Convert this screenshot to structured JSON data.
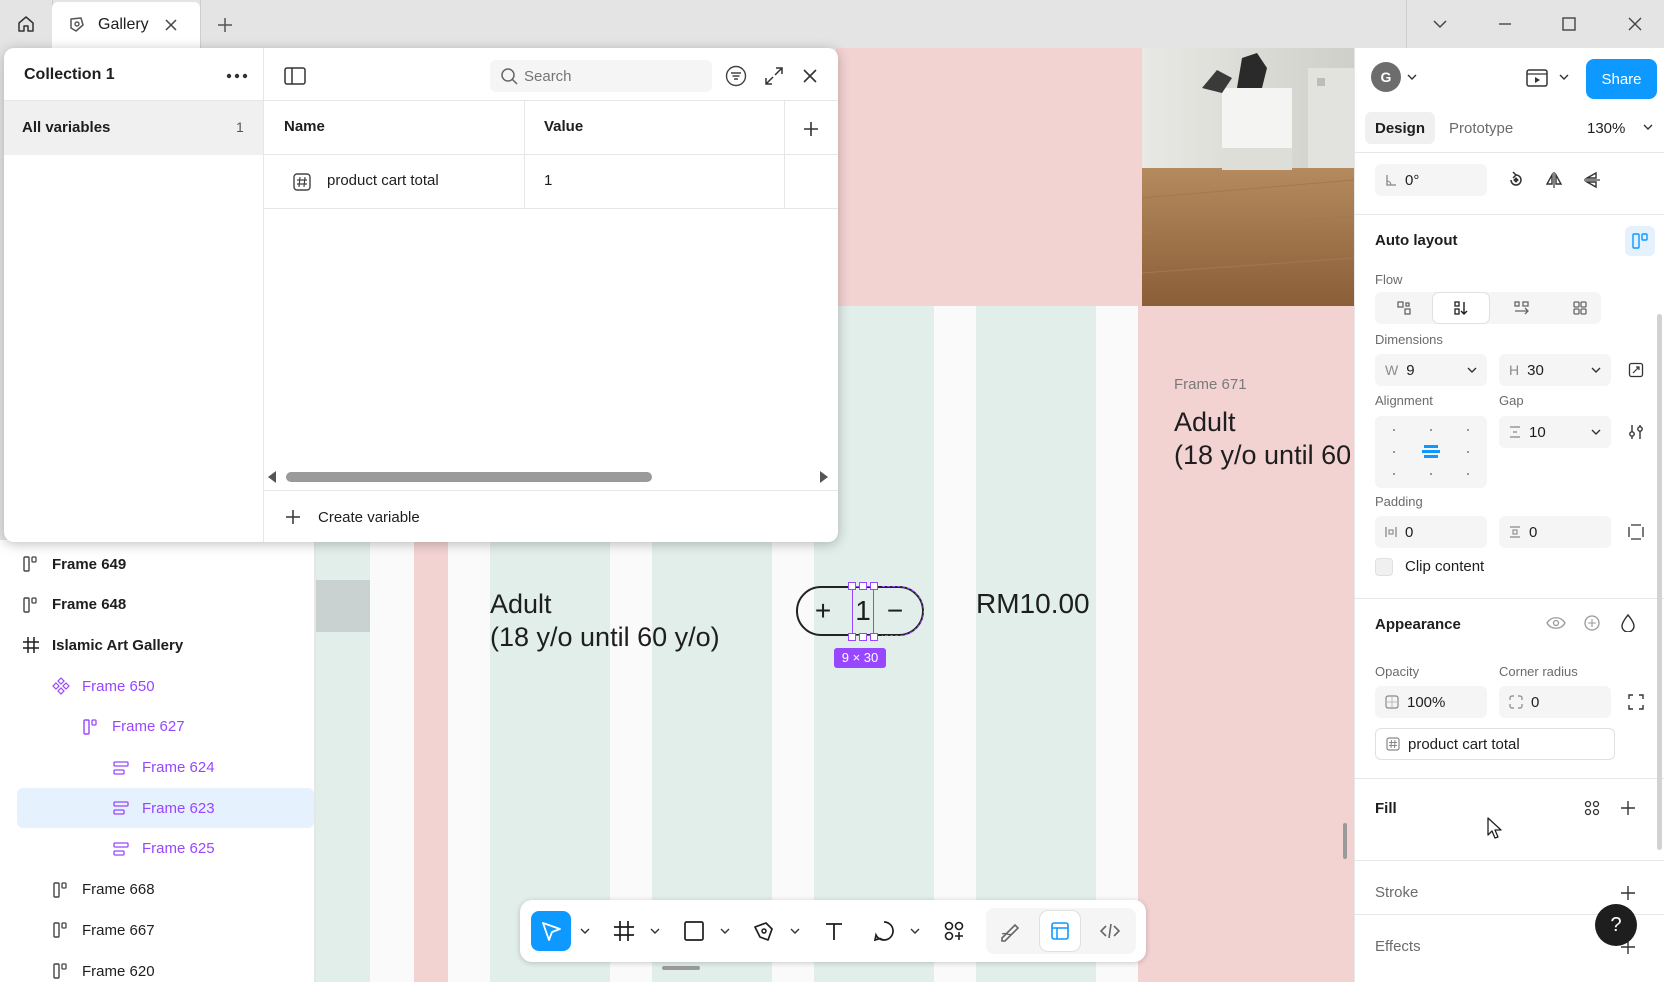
{
  "tab": {
    "title": "Gallery"
  },
  "variables_modal": {
    "collection_name": "Collection 1",
    "all_variables_label": "All variables",
    "all_variables_count": "1",
    "search_placeholder": "Search",
    "columns": {
      "name": "Name",
      "value": "Value"
    },
    "rows": [
      {
        "name": "product cart total",
        "value": "1"
      }
    ],
    "create_label": "Create variable"
  },
  "layers": [
    {
      "label": "Frame 649",
      "type": "autolayout",
      "indent": 0,
      "bold": true
    },
    {
      "label": "Frame 648",
      "type": "autolayout",
      "indent": 0,
      "bold": true
    },
    {
      "label": "Islamic Art Gallery",
      "type": "frame",
      "indent": 0,
      "bold": true
    },
    {
      "label": "Frame 650",
      "type": "component",
      "indent": 1
    },
    {
      "label": "Frame 627",
      "type": "autolayout-comp",
      "indent": 2
    },
    {
      "label": "Frame 624",
      "type": "row-comp",
      "indent": 3
    },
    {
      "label": "Frame 623",
      "type": "row-comp",
      "indent": 3,
      "selected": true
    },
    {
      "label": "Frame 625",
      "type": "row-comp",
      "indent": 3
    },
    {
      "label": "Frame 668",
      "type": "autolayout",
      "indent": 1
    },
    {
      "label": "Frame 667",
      "type": "autolayout",
      "indent": 1
    },
    {
      "label": "Frame 620",
      "type": "autolayout",
      "indent": 1
    }
  ],
  "canvas": {
    "ticket_line1": "Adult",
    "ticket_line2": "(18 y/o until 60 y/o)",
    "stepper_plus": "+",
    "stepper_value": "1",
    "stepper_minus": "−",
    "size_badge": "9 × 30",
    "price": "RM10.00",
    "frame_label": "Frame 671",
    "frame_line1": "Adult",
    "frame_line2": "(18 y/o until 60"
  },
  "right_panel": {
    "avatar_letter": "G",
    "share_label": "Share",
    "tabs": {
      "design": "Design",
      "prototype": "Prototype"
    },
    "zoom": "130%",
    "rotation": "0°",
    "auto_layout_title": "Auto layout",
    "flow_label": "Flow",
    "dimensions_label": "Dimensions",
    "width_prefix": "W",
    "width": "9",
    "height_prefix": "H",
    "height": "30",
    "alignment_label": "Alignment",
    "gap_label": "Gap",
    "gap": "10",
    "padding_label": "Padding",
    "padding_h": "0",
    "padding_v": "0",
    "clip_content_label": "Clip content",
    "appearance_title": "Appearance",
    "opacity_label": "Opacity",
    "opacity": "100%",
    "corner_radius_label": "Corner radius",
    "corner_radius": "0",
    "variable_binding": "product cart total",
    "fill_title": "Fill",
    "stroke_title": "Stroke",
    "effects_title": "Effects",
    "help_label": "?"
  },
  "colors": {
    "accent": "#0d99ff",
    "pink": "#f3d2d2",
    "mint": "#e2eeea",
    "component_purple": "#9747ff",
    "selection_bg": "#e5f1fd"
  }
}
